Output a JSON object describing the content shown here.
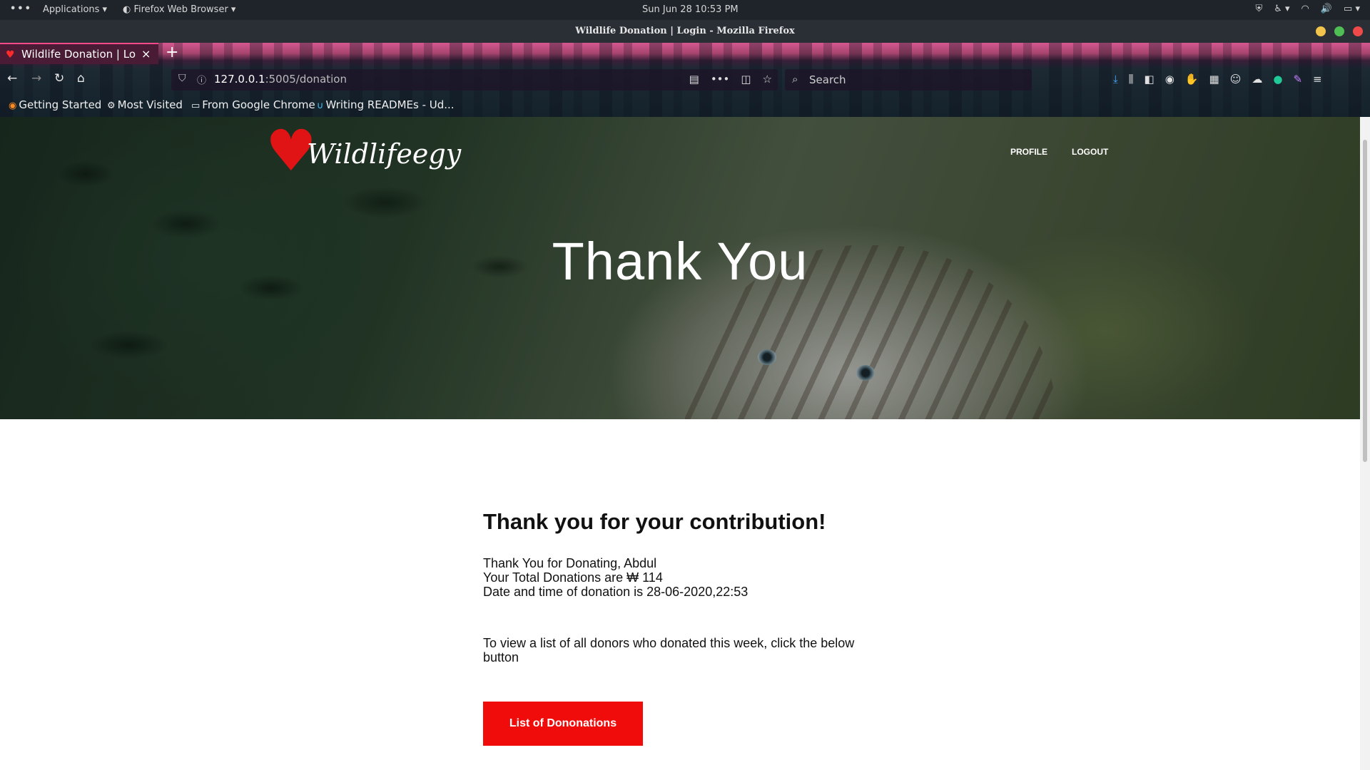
{
  "os": {
    "activities_icon": "three-dots-icon",
    "applications_label": "Applications",
    "app_name": "Firefox Web Browser",
    "clock": "Sun Jun 28  10:53 PM"
  },
  "window": {
    "title": "Wildlife Donation | Login - Mozilla Firefox",
    "controls": {
      "minimize_color": "#f1c54b",
      "maximize_color": "#4fbf55",
      "close_color": "#ef4a4a"
    }
  },
  "browser": {
    "tab_label": "Wildlife Donation | Login",
    "url_host": "127.0.0.1",
    "url_rest": ":5005/donation",
    "search_placeholder": "Search",
    "bookmarks": [
      {
        "label": "Getting Started",
        "icon": "firefox-icon"
      },
      {
        "label": "Most Visited",
        "icon": "gear-icon"
      },
      {
        "label": "From Google Chrome",
        "icon": "folder-icon"
      },
      {
        "label": "Writing READMEs - Ud...",
        "icon": "udacity-icon"
      }
    ]
  },
  "site": {
    "logo_text": "Wildlifeegy",
    "nav": {
      "profile": "PROFILE",
      "logout": "LOGOUT"
    },
    "hero_title": "Thank You"
  },
  "main": {
    "heading": "Thank you for your contribution!",
    "line1": "Thank You for Donating, Abdul",
    "line2": "Your Total Donations are ₩ 114",
    "line3": "Date and time of donation is 28-06-2020,22:53",
    "view_text": "To view a list of all donors who donated this week, click the below button",
    "button_label": "List of Dononations",
    "accent_color": "#f10c0c"
  }
}
